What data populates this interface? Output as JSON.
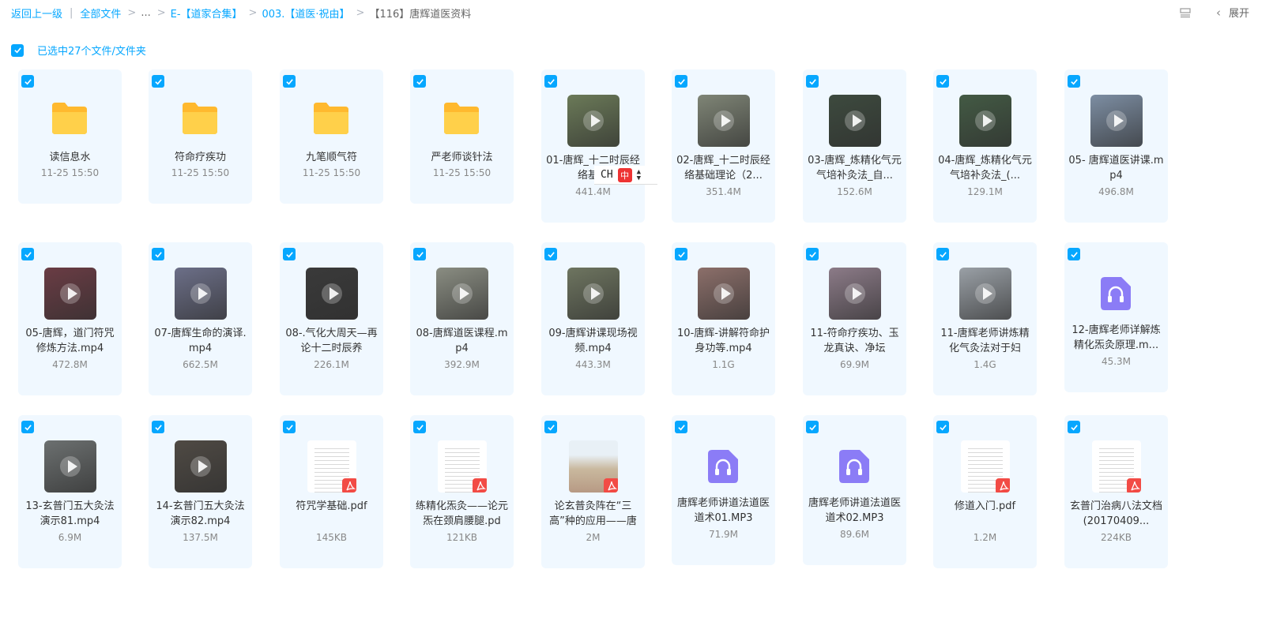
{
  "breadcrumb": {
    "back": "返回上一级",
    "all_files": "全部文件",
    "ellipsis": "...",
    "path": [
      "E-【道家合集】",
      "003.【道医·祝由】"
    ],
    "current": "【116】唐辉道医资料"
  },
  "toolbar": {
    "expand_label": "展开"
  },
  "selection": {
    "label": "已选中27个文件/文件夹"
  },
  "colors": {
    "accent": "#06a7ff",
    "card_bg": "#f0f8ff",
    "folder": "#ffc53d",
    "audio": "#8b7cf6",
    "pdf": "#f24b45"
  },
  "files": [
    {
      "type": "folder",
      "name": "读信息水",
      "meta": "11-25 15:50"
    },
    {
      "type": "folder",
      "name": "符命疗疾功",
      "meta": "11-25 15:50"
    },
    {
      "type": "folder",
      "name": "九笔顺气符",
      "meta": "11-25 15:50"
    },
    {
      "type": "folder",
      "name": "严老师谈针法",
      "meta": "11-25 15:50"
    },
    {
      "type": "video",
      "name": "01-唐辉_十二时辰经络基础",
      "meta": "441.4M",
      "thumb": "#6b7a58"
    },
    {
      "type": "video",
      "name": "02-唐辉_十二时辰经络基础理论（2...",
      "meta": "351.4M",
      "thumb": "#7f8576"
    },
    {
      "type": "video",
      "name": "03-唐辉_炼精化气元气培补灸法_自...",
      "meta": "152.6M",
      "thumb": "#3d4a3e"
    },
    {
      "type": "video",
      "name": "04-唐辉_炼精化气元气培补灸法_(...",
      "meta": "129.1M",
      "thumb": "#435a44"
    },
    {
      "type": "video",
      "name": "05- 唐辉道医讲课.mp4",
      "meta": "496.8M",
      "thumb": "#7d8ea3"
    },
    {
      "type": "video",
      "name": "05-唐辉，道门符咒修炼方法.mp4",
      "meta": "472.8M",
      "thumb": "#6a3c44"
    },
    {
      "type": "video",
      "name": "07-唐辉生命的演译.mp4",
      "meta": "662.5M",
      "thumb": "#6c6f88"
    },
    {
      "type": "video",
      "name": "08-.气化大周天—再论十二时辰养",
      "meta": "226.1M",
      "thumb": "#3a3a3a"
    },
    {
      "type": "video",
      "name": "08-唐辉道医课程.mp4",
      "meta": "392.9M",
      "thumb": "#8a8d82"
    },
    {
      "type": "video",
      "name": "09-唐辉讲课现场视频.mp4",
      "meta": "443.3M",
      "thumb": "#6e7560"
    },
    {
      "type": "video",
      "name": "10-唐辉-讲解符命护身功等.mp4",
      "meta": "1.1G",
      "thumb": "#8c6f6a"
    },
    {
      "type": "video",
      "name": "11-符命疗疾功、玉龙真诀、净坛",
      "meta": "69.9M",
      "thumb": "#8c7b88"
    },
    {
      "type": "video",
      "name": "11-唐辉老师讲炼精化气灸法对于妇",
      "meta": "1.4G",
      "thumb": "#9aa0a6"
    },
    {
      "type": "audio",
      "name": "12-唐辉老师详解炼精化炁灸原理.m...",
      "meta": "45.3M"
    },
    {
      "type": "video",
      "name": "13-玄普门五大灸法演示81.mp4",
      "meta": "6.9M",
      "thumb": "#6c7070"
    },
    {
      "type": "video",
      "name": "14-玄普门五大灸法演示82.mp4",
      "meta": "137.5M",
      "thumb": "#4f4a44"
    },
    {
      "type": "pdf",
      "name": "符咒学基础.pdf",
      "meta": "145KB"
    },
    {
      "type": "pdf",
      "name": "练精化炁灸——论元炁在颈肩腰腿.pd",
      "meta": "121KB"
    },
    {
      "type": "pdf",
      "name": "论玄普灸阵在“三高”种的应用——唐",
      "meta": "2M",
      "image": true
    },
    {
      "type": "audio",
      "name": "唐辉老师讲道法道医道术01.MP3",
      "meta": "71.9M"
    },
    {
      "type": "audio",
      "name": "唐辉老师讲道法道医道术02.MP3",
      "meta": "89.6M"
    },
    {
      "type": "pdf",
      "name": "修道入门.pdf",
      "meta": "1.2M"
    },
    {
      "type": "pdf",
      "name": "玄普门治病八法文档(20170409...",
      "meta": "224KB"
    }
  ],
  "ime": {
    "mode": "CH",
    "seal": "中"
  }
}
